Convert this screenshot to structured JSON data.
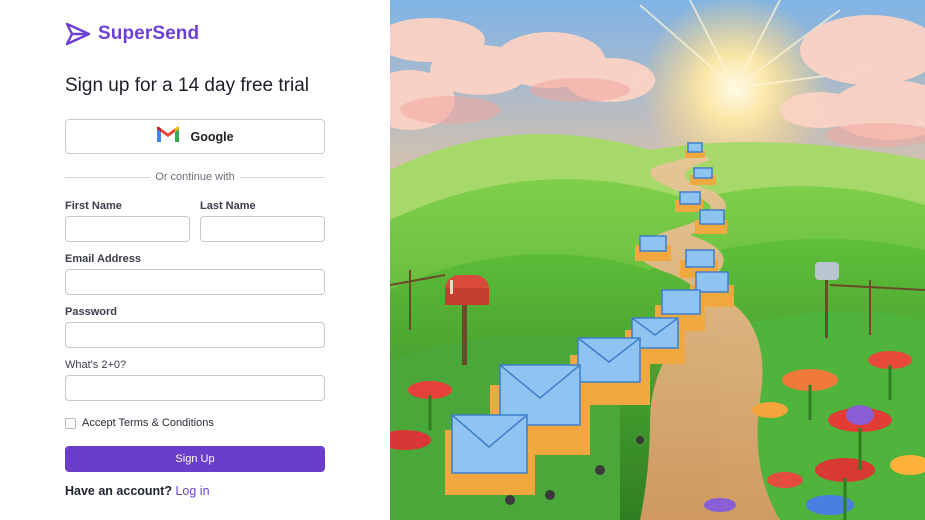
{
  "brand": {
    "name": "SuperSend",
    "logo_icon": "paper-plane-icon",
    "color": "#6d3fd6"
  },
  "page": {
    "title": "Sign up for a 14 day free trial"
  },
  "google": {
    "label": "Google",
    "icon": "gmail-icon"
  },
  "divider": {
    "text": "Or continue with"
  },
  "form": {
    "first_name": {
      "label": "First Name",
      "value": ""
    },
    "last_name": {
      "label": "Last Name",
      "value": ""
    },
    "email": {
      "label": "Email Address",
      "value": ""
    },
    "password": {
      "label": "Password",
      "value": ""
    },
    "captcha": {
      "label": "What's 2+0?",
      "value": ""
    },
    "terms": {
      "label": "Accept Terms & Conditions",
      "checked": false
    },
    "submit_label": "Sign Up"
  },
  "footer": {
    "prompt": "Have an account?",
    "login_link": "Log in"
  },
  "colors": {
    "primary": "#6a3ec9",
    "border": "#c5c8d0"
  },
  "hero": {
    "image": "illustration of envelopes on carts traveling a winding path through green hills at sunrise"
  }
}
